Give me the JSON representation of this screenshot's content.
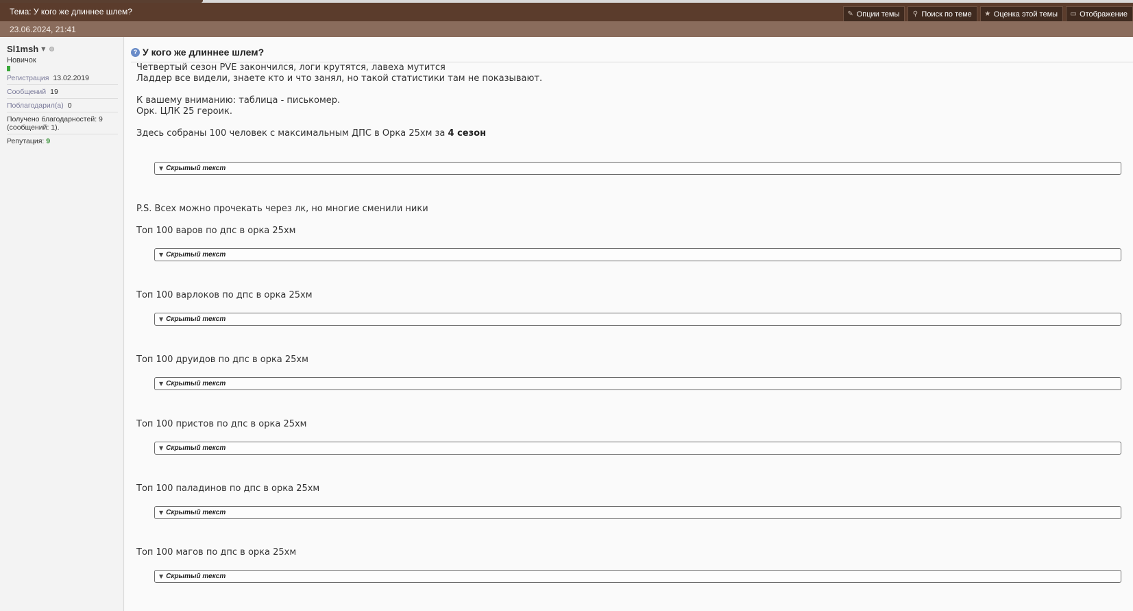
{
  "thread": {
    "title": "Тема: У кого же длиннее шлем?",
    "toolbar": [
      {
        "icon": "wrench-icon",
        "glyph": "✎",
        "label": "Опции темы"
      },
      {
        "icon": "search-icon",
        "glyph": "⚲",
        "label": "Поиск по теме"
      },
      {
        "icon": "star-icon",
        "glyph": "★",
        "label": "Оценка этой темы"
      },
      {
        "icon": "monitor-icon",
        "glyph": "▭",
        "label": "Отображение"
      }
    ]
  },
  "post": {
    "date": "23.06.2024, 21:41",
    "title": "У кого же длиннее шлем?",
    "lines": [
      "Четвертый сезон PVE закончился, логи крутятся, лавеха мутится",
      "Ладдер все видели, знаете кто и что занял, но такой статистики там не показывают.",
      "К вашему вниманию: таблица - писькомер.",
      "Орк. ЦЛК 25 героик.",
      "Здесь собраны 100 человек с максимальным ДПС в Орка 25хм за ",
      "P.S. Всех можно прочекать через лк, но многие сменили ники",
      "Топ 100 варов по дпс в орка 25хм",
      "Топ 100 варлоков по дпс в орка 25хм",
      "Топ 100 друидов по дпс в орка 25хм",
      "Топ 100 пристов по дпс в орка 25хм",
      "Топ 100 паладинов по дпс в орка 25хм",
      "Топ 100 магов по дпс в орка 25хм"
    ],
    "season_bold": "4 сезон",
    "spoiler_label": "Скрытый текст"
  },
  "user": {
    "name": "Sl1msh",
    "rank": "Новичок",
    "reg_label": "Регистрация",
    "reg_value": "13.02.2019",
    "posts_label": "Сообщений",
    "posts_value": "19",
    "thanked_label": "Поблагодарил(а)",
    "thanked_value": "0",
    "received_thanks": "Получено благодарностей: 9 (сообщений: 1).",
    "rep_label": "Репутация:",
    "rep_value": "9"
  }
}
